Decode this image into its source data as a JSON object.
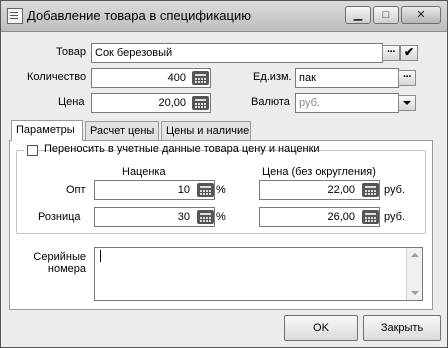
{
  "window": {
    "title": "Добавление товара в спецификацию",
    "minimize_glyph": "▁",
    "maximize_glyph": "□",
    "close_glyph": "✕"
  },
  "form": {
    "product_label": "Товар",
    "product_value": "Сок березовый",
    "quantity_label": "Количество",
    "quantity_value": "400",
    "unit_label": "Ед.изм.",
    "unit_value": "пак",
    "price_label": "Цена",
    "price_value": "20,00",
    "currency_label": "Валюта",
    "currency_value": "руб."
  },
  "tabs": [
    {
      "label": "Параметры",
      "active": true
    },
    {
      "label": "Расчет цены",
      "active": false
    },
    {
      "label": "Цены и наличие",
      "active": false
    }
  ],
  "params": {
    "transfer_checkbox_label": "Переносить в учетные данные товара цену и наценки",
    "transfer_checked": false,
    "markup_header": "Наценка",
    "price_header": "Цена (без округления)",
    "rows": [
      {
        "label": "Опт",
        "markup": "10",
        "percent": "%",
        "price": "22,00",
        "currency": "руб."
      },
      {
        "label": "Розница",
        "markup": "30",
        "percent": "%",
        "price": "26,00",
        "currency": "руб."
      }
    ],
    "serial_label_line1": "Серийные",
    "serial_label_line2": "номера",
    "serial_value": ""
  },
  "footer": {
    "ok_label": "OK",
    "close_label": "Закрыть"
  },
  "icons": {
    "ellipsis": "···",
    "check": "✔"
  }
}
